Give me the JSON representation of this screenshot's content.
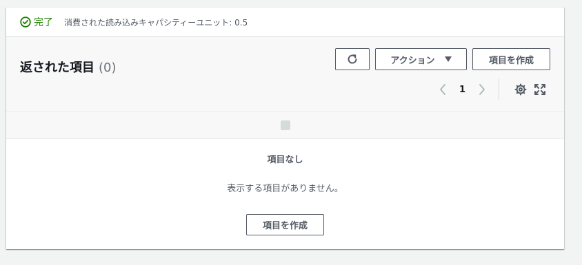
{
  "status": {
    "label": "完了",
    "capacity": "消費された読み込みキャパシティーユニット: 0.5",
    "color": "#1d8102",
    "icon": "check-circle-icon"
  },
  "header": {
    "title": "返された項目",
    "count": "(0)",
    "actions_label": "アクション",
    "create_label": "項目を作成",
    "refresh_icon": "refresh-icon"
  },
  "pagination": {
    "current_page": "1"
  },
  "empty_state": {
    "title": "項目なし",
    "description": "表示する項目がありません。",
    "create_label": "項目を作成"
  }
}
